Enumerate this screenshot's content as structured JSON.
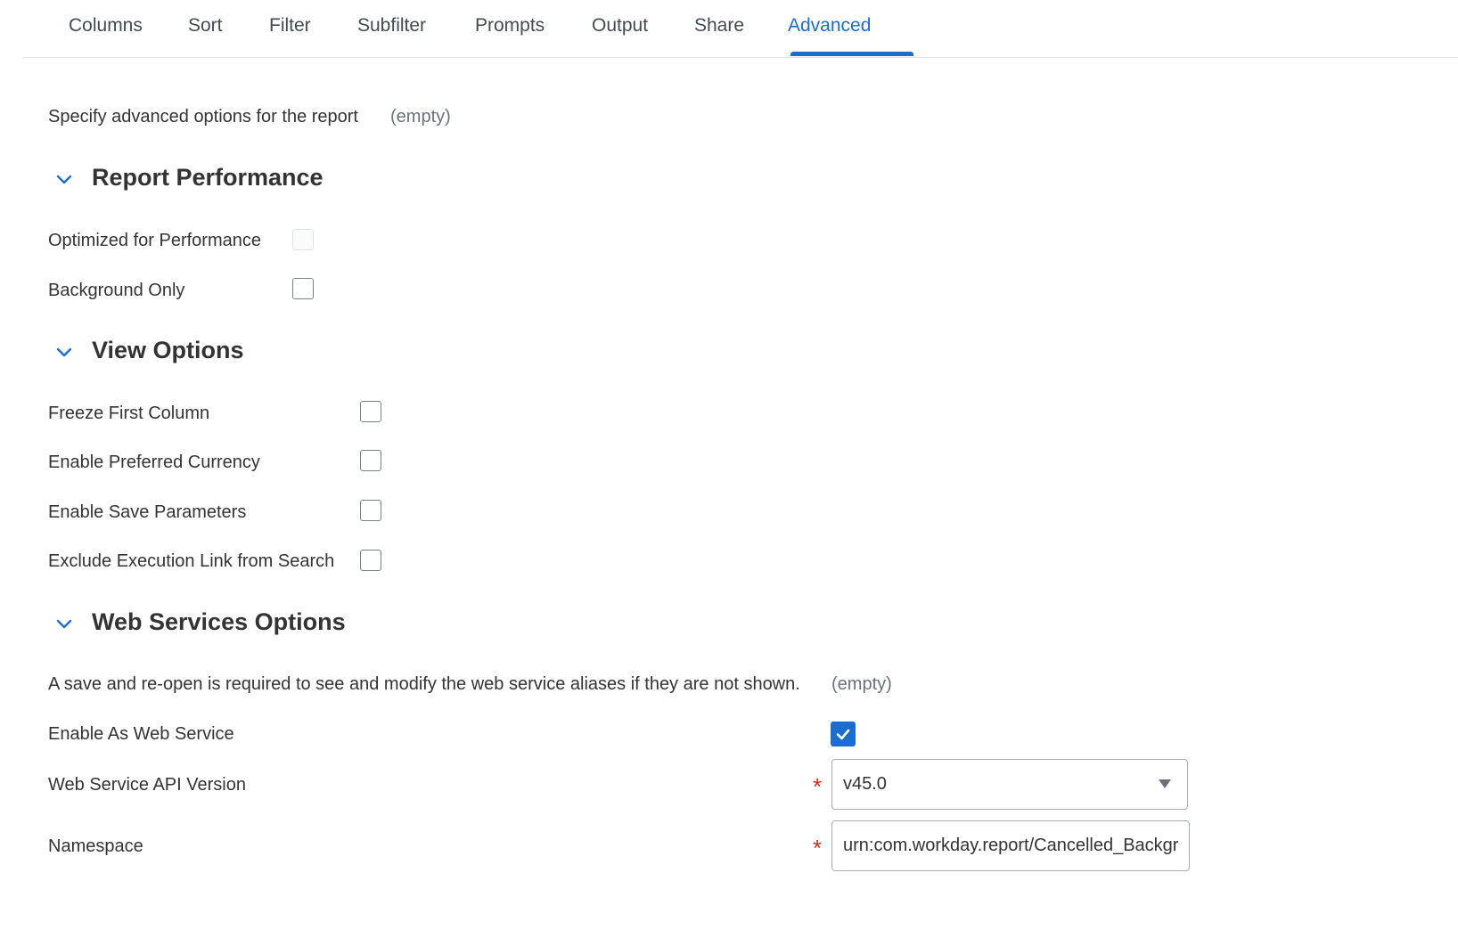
{
  "tabs": [
    "Columns",
    "Sort",
    "Filter",
    "Subfilter",
    "Prompts",
    "Output",
    "Share",
    "Advanced"
  ],
  "active_tab": "Advanced",
  "intro": {
    "label": "Specify advanced options for the report",
    "value": "(empty)"
  },
  "sections": {
    "report_performance": {
      "title": "Report Performance",
      "optimized_label": "Optimized for Performance",
      "background_label": "Background Only"
    },
    "view_options": {
      "title": "View Options",
      "freeze_label": "Freeze First Column",
      "currency_label": "Enable Preferred Currency",
      "save_params_label": "Enable Save Parameters",
      "exclude_link_label": "Exclude Execution Link from Search"
    },
    "web_services": {
      "title": "Web Services Options",
      "note": "A save and re-open is required to see and modify the web service aliases if they are not shown.",
      "note_value": "(empty)",
      "enable_label": "Enable As Web Service",
      "enable_checked": true,
      "api_version_label": "Web Service API Version",
      "api_version_value": "v45.0",
      "namespace_label": "Namespace",
      "namespace_value": "urn:com.workday.report/Cancelled_Backgr",
      "required_mark": "*"
    }
  },
  "colors": {
    "accent": "#1b6ed1",
    "required": "#d12a1f"
  }
}
